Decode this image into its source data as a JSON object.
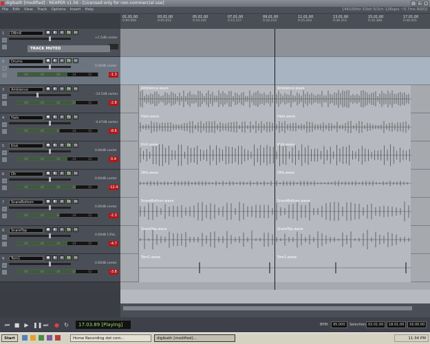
{
  "window": {
    "title": "digibath [modified] - REAPER v1.56 - [Licensed only for non-commercial use]",
    "controls": [
      "_",
      "□",
      "×"
    ]
  },
  "menu": {
    "items": [
      "File",
      "Edit",
      "View",
      "Track",
      "Options",
      "Insert",
      "Help"
    ],
    "status": "[44100Hz 32bit 0/2ch 126spls ~5.7ms ASIO]"
  },
  "ruler": {
    "markers": [
      {
        "bar": "01.01.00",
        "time": "0:00.000"
      },
      {
        "bar": "03.01.00",
        "time": "0:05.052"
      },
      {
        "bar": "05.01.00",
        "time": "0:10.105"
      },
      {
        "bar": "07.01.00",
        "time": "0:15.157"
      },
      {
        "bar": "09.01.00",
        "time": "0:20.210"
      },
      {
        "bar": "11.01.00",
        "time": "0:25.263"
      },
      {
        "bar": "13.01.00",
        "time": "0:30.315"
      },
      {
        "bar": "15.01.00",
        "time": "0:35.368"
      },
      {
        "bar": "17.01.00",
        "time": "0:40.421"
      }
    ]
  },
  "tracks": [
    {
      "num": "1",
      "name": "DBm6",
      "vol": "+1.5dB center",
      "peak": "",
      "muted_label": "TRACK MUTED"
    },
    {
      "num": "2",
      "name": "Drums",
      "vol": "0.00dB center",
      "peak": "-1.3"
    },
    {
      "num": "3",
      "name": "Ambience",
      "vol": "-14.5dB center",
      "peak": "-2.8"
    },
    {
      "num": "4",
      "name": "Hats",
      "vol": "-4.47dB center",
      "peak": "-8.6"
    },
    {
      "num": "5",
      "name": "Kick",
      "vol": "0.00dB center",
      "peak": "0.4"
    },
    {
      "num": "6",
      "name": "Oh",
      "vol": "0.00dB center",
      "peak": "-12.4"
    },
    {
      "num": "7",
      "name": "SnareBottom",
      "vol": "0.00dB center",
      "peak": "-2.3"
    },
    {
      "num": "8",
      "name": "SnareTop",
      "vol": "0.00dB 13%L",
      "peak": "-4.7"
    },
    {
      "num": "9",
      "name": "Tom1",
      "vol": "0.00dB center",
      "peak": "-3.8"
    }
  ],
  "items": {
    "ambience": [
      "Ambience.wave",
      "Ambience.wave"
    ],
    "hats": [
      "Hats.wave",
      "Hats.wave"
    ],
    "kick": [
      "Kick.wave",
      "Kick.wave"
    ],
    "oh": [
      "OHs.wave",
      "OHs.wave"
    ],
    "snarebottom": [
      "SnareBottom.wave",
      "SnareBottom.wave"
    ],
    "snaretop": [
      "SnareTop.wave",
      "SnareTop.wave"
    ],
    "tom1": [
      "Tom1.wave",
      "Tom1.wave"
    ]
  },
  "meter_ticks": [
    "-60",
    "-40",
    "-36",
    "-24",
    "-12"
  ],
  "transport": {
    "time": "17.03.89 [Playing]",
    "bpm_label": "BPM:",
    "bpm": "95.000",
    "selection_label": "Selection:",
    "sel_start": "02.01.00",
    "sel_end": "18.01.00",
    "sel_len": "16.00.00"
  },
  "taskbar": {
    "start": "Start",
    "tasks": [
      "Home Recording dot com...",
      "digibath [modified]..."
    ],
    "clock": "11:34 PM"
  },
  "colors": {
    "peak_red": "#b01818",
    "time_green": "#9adf6f"
  }
}
